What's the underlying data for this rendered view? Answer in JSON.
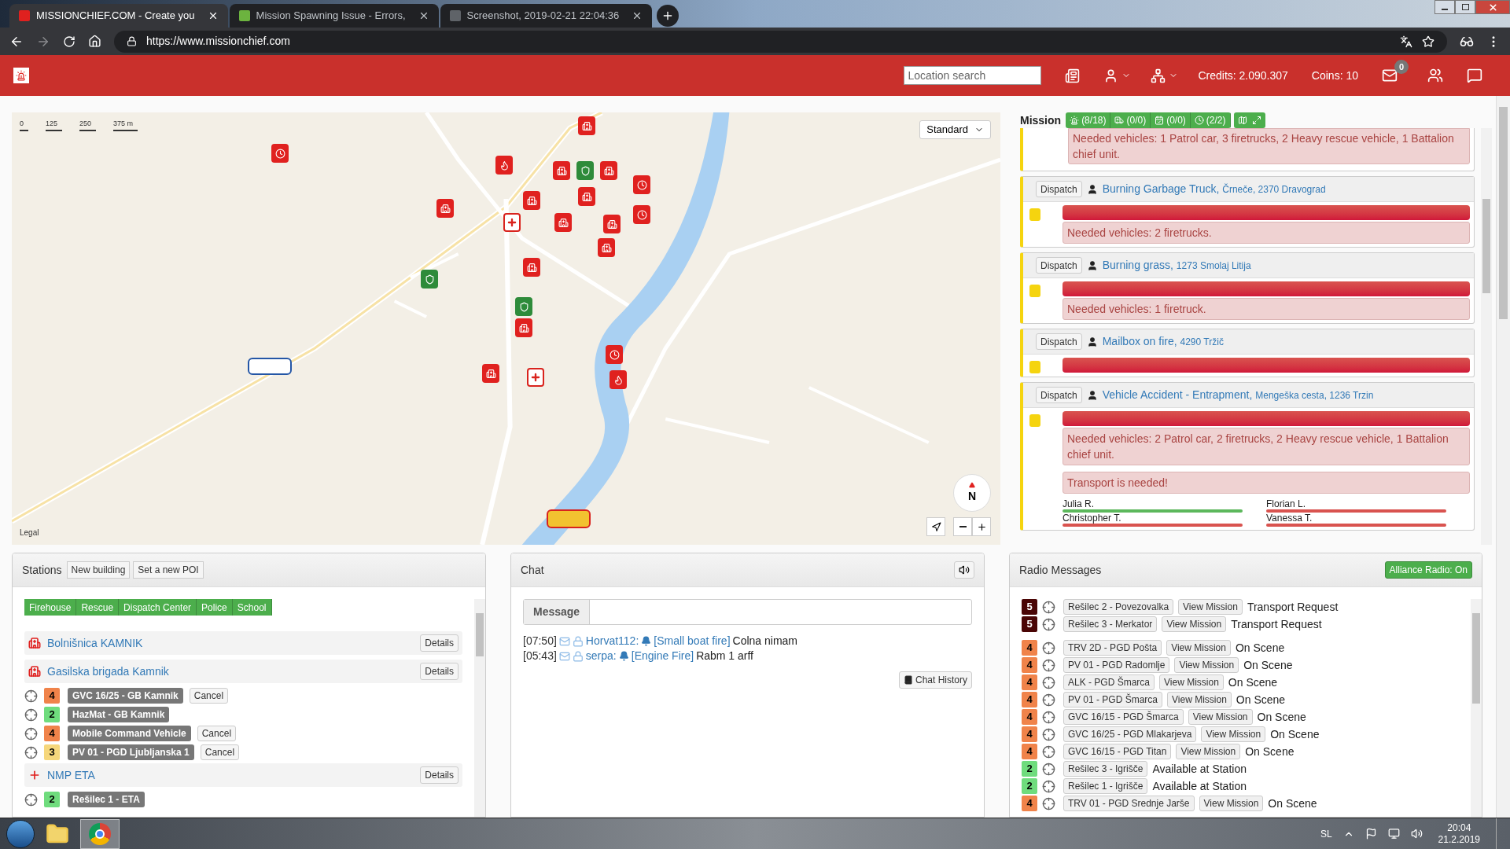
{
  "browser": {
    "tabs": [
      {
        "title": "MISSIONCHIEF.COM - Create you",
        "selected": true
      },
      {
        "title": "Mission Spawning Issue - Errors,",
        "selected": false
      },
      {
        "title": "Screenshot, 2019-02-21 22:04:36",
        "selected": false
      }
    ],
    "url": "https://www.missionchief.com"
  },
  "header": {
    "search_placeholder": "Location search",
    "credits": "Credits: 2.090.307",
    "coins": "Coins: 10",
    "unread_messages": "0"
  },
  "map": {
    "style": "Standard",
    "scale": [
      "0",
      "125",
      "250",
      "375 m"
    ],
    "compass": "N",
    "legal": "Legal"
  },
  "missions": {
    "title": "Mission",
    "counters": [
      {
        "kind": "emergency",
        "label": "(8/18)"
      },
      {
        "kind": "ambulance",
        "label": "(0/0)"
      },
      {
        "kind": "event",
        "label": "(0/0)"
      },
      {
        "kind": "time",
        "label": "(2/2)"
      }
    ],
    "items": [
      {
        "kind": "cut",
        "needed": "Needed vehicles: 1 Patrol car, 3 firetrucks, 2 Heavy rescue vehicle, 1 Battalion chief unit."
      },
      {
        "kind": "full",
        "dispatch": "Dispatch",
        "name": "Burning Garbage Truck,",
        "address": "Črneče, 2370 Dravograd",
        "level": 1,
        "needed": "Needed vehicles: 2 firetrucks."
      },
      {
        "kind": "full",
        "dispatch": "Dispatch",
        "name": "Burning grass,",
        "address": "1273 Smolaj Litija",
        "level": 1,
        "needed": "Needed vehicles: 1 firetruck."
      },
      {
        "kind": "full",
        "dispatch": "Dispatch",
        "name": "Mailbox on fire,",
        "address": "4290 Tržič",
        "level": 1
      },
      {
        "kind": "full",
        "dispatch": "Dispatch",
        "name": "Vehicle Accident - Entrapment,",
        "address": "Mengeška cesta, 1236 Trzin",
        "level": 1,
        "needed": "Needed vehicles: 2 Patrol car, 2 firetrucks, 2 Heavy rescue vehicle, 1 Battalion chief unit.",
        "transport": "Transport is needed!",
        "patients": [
          {
            "name": "Julia R.",
            "color": "#5cb85c"
          },
          {
            "name": "Florian L.",
            "color": "#d9534f"
          },
          {
            "name": "Christopher T.",
            "color": "#d9534f"
          },
          {
            "name": "Vanessa T.",
            "color": "#d9534f"
          }
        ]
      }
    ]
  },
  "stations": {
    "title": "Stations",
    "buttons": [
      "New building",
      "Set a new POI"
    ],
    "filters": [
      {
        "label": "Firehouse",
        "selected": true
      },
      {
        "label": "Rescue",
        "selected": true
      },
      {
        "label": "Dispatch Center",
        "selected": true
      },
      {
        "label": "Police",
        "selected": true
      },
      {
        "label": "School",
        "selected": true
      }
    ],
    "buildings": [
      {
        "kind": "hospital",
        "name": "Bolnišnica KAMNIK",
        "details": "Details"
      },
      {
        "kind": "fire",
        "name": "Gasilska brigada Kamnik",
        "details": "Details",
        "vehicles": [
          {
            "status": "4",
            "color": "#f0834a",
            "name": "GVC 16/25 - GB Kamnik",
            "cancel": "Cancel"
          },
          {
            "status": "2",
            "color": "#6fdc7d",
            "name": "HazMat - GB Kamnik"
          },
          {
            "status": "4",
            "color": "#f0834a",
            "name": "Mobile Command Vehicle",
            "cancel": "Cancel"
          },
          {
            "status": "3",
            "color": "#f6d77c",
            "name": "PV 01 - PGD Ljubljanska 1",
            "cancel": "Cancel"
          }
        ]
      },
      {
        "kind": "ambulance",
        "name": "NMP ETA",
        "details": "Details",
        "vehicles": [
          {
            "status": "2",
            "color": "#6fdc7d",
            "name": "Rešilec 1 - ETA"
          }
        ]
      }
    ]
  },
  "chat": {
    "title": "Chat",
    "input_label": "Message",
    "messages": [
      {
        "time": "[07:50]",
        "user": "Horvat112:",
        "mission": "[Small boat fire]",
        "text": "Colna nimam"
      },
      {
        "time": "[05:43]",
        "user": "serpa:",
        "mission": "[Engine Fire]",
        "text": "Rabm 1 arff"
      }
    ],
    "history": "Chat History"
  },
  "radio": {
    "title": "Radio Messages",
    "alliance": {
      "label": "Alliance Radio: On",
      "on": true
    },
    "messages": [
      {
        "status": "5",
        "color": "#4a0505",
        "vehicle": "Rešilec 2 - Povezovalka",
        "view": "View Mission",
        "text": "Transport Request"
      },
      {
        "status": "5",
        "color": "#4a0505",
        "vehicle": "Rešilec 3 - Merkator",
        "view": "View Mission",
        "text": "Transport Request"
      },
      {
        "status": "4",
        "color": "#f0834a",
        "vehicle": "TRV 2D - PGD Pošta",
        "view": "View Mission",
        "text": "On Scene"
      },
      {
        "status": "4",
        "color": "#f0834a",
        "vehicle": "PV 01 - PGD Radomlje",
        "view": "View Mission",
        "text": "On Scene"
      },
      {
        "status": "4",
        "color": "#f0834a",
        "vehicle": "ALK - PGD Šmarca",
        "view": "View Mission",
        "text": "On Scene"
      },
      {
        "status": "4",
        "color": "#f0834a",
        "vehicle": "PV 01 - PGD Šmarca",
        "view": "View Mission",
        "text": "On Scene"
      },
      {
        "status": "4",
        "color": "#f0834a",
        "vehicle": "GVC 16/15 - PGD Šmarca",
        "view": "View Mission",
        "text": "On Scene"
      },
      {
        "status": "4",
        "color": "#f0834a",
        "vehicle": "GVC 16/25 - PGD Mlakarjeva",
        "view": "View Mission",
        "text": "On Scene"
      },
      {
        "status": "4",
        "color": "#f0834a",
        "vehicle": "GVC 16/15 - PGD Titan",
        "view": "View Mission",
        "text": "On Scene"
      },
      {
        "status": "2",
        "color": "#6fdc7d",
        "vehicle": "Rešilec 3 - Igrišče",
        "text": "Available at Station"
      },
      {
        "status": "2",
        "color": "#6fdc7d",
        "vehicle": "Rešilec 1 - Igrišče",
        "text": "Available at Station"
      },
      {
        "status": "4",
        "color": "#f0834a",
        "vehicle": "TRV 01 - PGD Srednje Jarše",
        "view": "View Mission",
        "text": "On Scene"
      }
    ]
  },
  "taskbar": {
    "language": "SL",
    "time": "20:04",
    "date": "21.2.2019"
  }
}
